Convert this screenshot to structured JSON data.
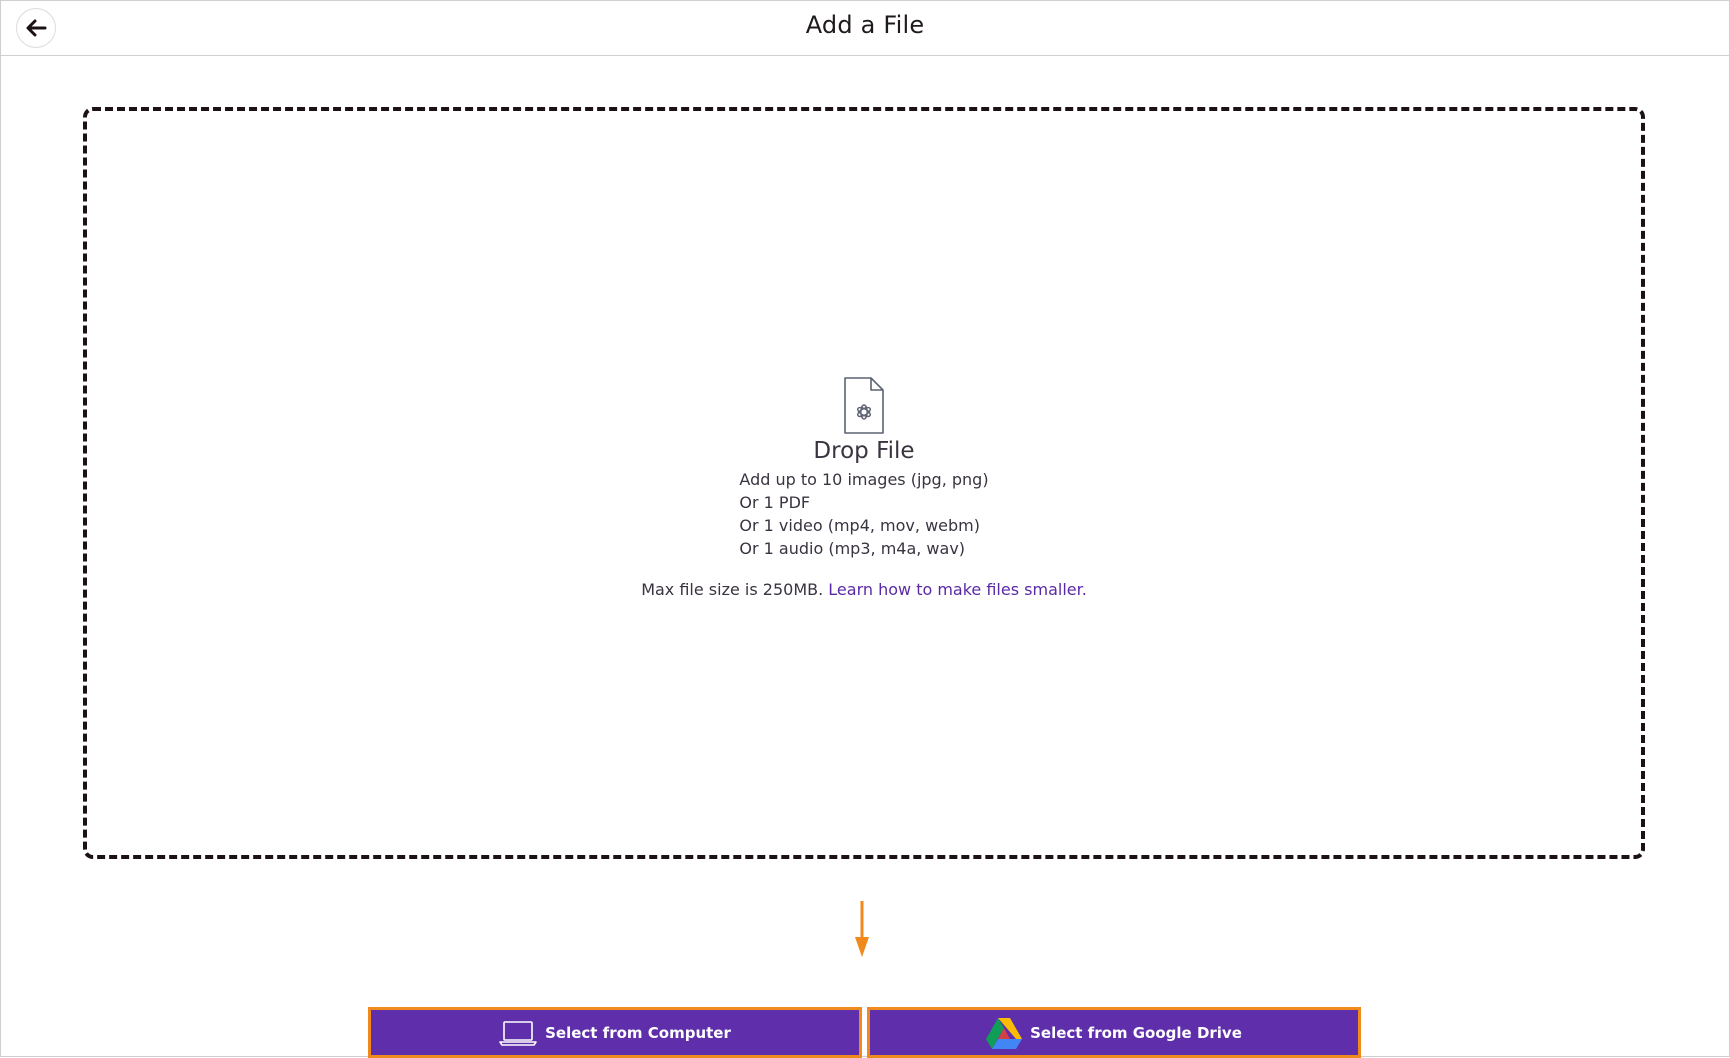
{
  "header": {
    "title": "Add a File",
    "back_icon": "arrow-left-icon"
  },
  "dropzone": {
    "icon": "file-document-icon",
    "title": "Drop File",
    "rules": [
      "Add up to 10 images (jpg, png)",
      "Or 1 PDF",
      "Or 1 video (mp4, mov, webm)",
      "Or 1 audio (mp3, m4a, wav)"
    ],
    "max_size_text": "Max file size is 250MB.",
    "learn_link": "Learn how to make files smaller."
  },
  "actions": {
    "computer_label": "Select from Computer",
    "computer_icon": "laptop-icon",
    "drive_label": "Select from Google Drive",
    "drive_icon": "google-drive-icon"
  },
  "colors": {
    "button_bg": "#5e2eab",
    "button_border": "#f08a1c",
    "link": "#5a2aa6",
    "arrow": "#f08a1c"
  }
}
